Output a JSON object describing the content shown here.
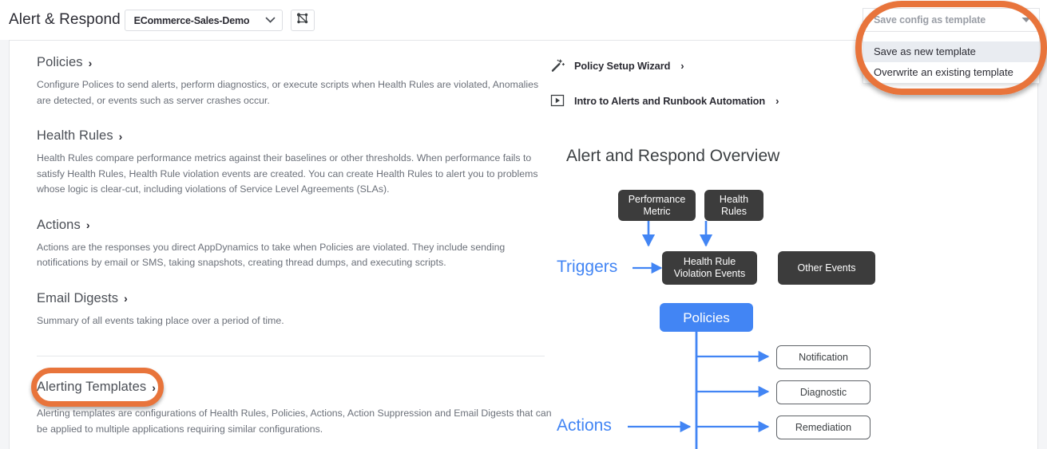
{
  "header": {
    "title": "Alert & Respond",
    "app_selector": {
      "value": "ECommerce-Sales-Demo",
      "chevron_icon": "chevron-down-icon"
    },
    "flowmap_icon": "flow-map-icon"
  },
  "save_config": {
    "button_label": "Save config as template",
    "caret_icon": "caret-down-icon",
    "menu_items": [
      {
        "label": "Save as new template",
        "hovered": true
      },
      {
        "label": "Overwrite an existing template",
        "hovered": false
      }
    ]
  },
  "left_sections": [
    {
      "title": "Policies",
      "arrow": "›",
      "body": "Configure Polices to send alerts, perform diagnostics, or execute scripts when Health Rules are violated, Anomalies are detected, or events such as server crashes occur."
    },
    {
      "title": "Health Rules",
      "arrow": "›",
      "body": "Health Rules compare performance metrics against their baselines or other thresholds. When performance fails to satisfy Health Rules, Health Rule violation events are created. You can create Health Rules to alert you to problems whose logic is clear-cut, including violations of Service Level Agreements (SLAs)."
    },
    {
      "title": "Actions",
      "arrow": "›",
      "body": "Actions are the responses you direct AppDynamics to take when Policies are violated. They include sending notifications by email or SMS, taking snapshots, creating thread dumps, and executing scripts."
    },
    {
      "title": "Email Digests",
      "arrow": "›",
      "body": "Summary of all events taking place over a period of time."
    }
  ],
  "alerting_templates": {
    "title": "Alerting Templates",
    "arrow": "›",
    "body": "Alerting templates are configurations of Health Rules, Policies, Actions, Action Suppression and Email Digests that can be applied to multiple applications requiring similar configurations.",
    "highlighted": true
  },
  "right_links": [
    {
      "label": "Policy Setup Wizard",
      "arrow": "›",
      "icon": "magic-wand-icon"
    },
    {
      "label": "Intro to Alerts and Runbook Automation",
      "arrow": "›",
      "icon": "video-play-icon"
    }
  ],
  "diagram": {
    "title": "Alert and Respond Overview",
    "labels": [
      {
        "text": "Triggers"
      },
      {
        "text": "Actions"
      }
    ],
    "dark_boxes": [
      {
        "text": "Performance\nMetric",
        "line1": "Performance",
        "line2": "Metric"
      },
      {
        "text": "Health\nRules",
        "line1": "Health",
        "line2": "Rules"
      },
      {
        "text": "Health Rule\nViolation Events",
        "line1": "Health Rule",
        "line2": "Violation Events"
      },
      {
        "text": "Other Events",
        "line1": "Other Events",
        "line2": ""
      }
    ],
    "blue_box": {
      "text": "Policies"
    },
    "outline_boxes": [
      {
        "text": "Notification"
      },
      {
        "text": "Diagnostic"
      },
      {
        "text": "Remediation"
      }
    ]
  },
  "colors": {
    "annotation_orange": "#e8743b",
    "diagram_blue": "#4285f4",
    "diagram_dark": "#3c3c3c",
    "page_bg": "#f4f5f7"
  }
}
